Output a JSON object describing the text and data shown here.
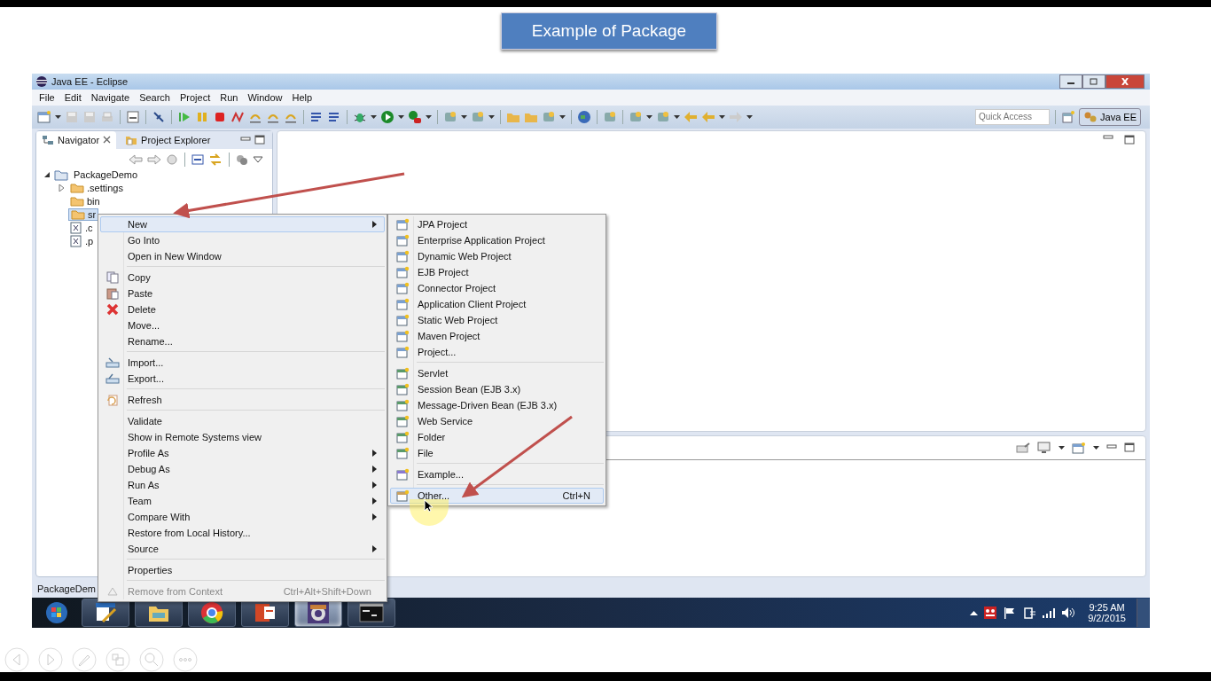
{
  "slide_title": "Example of Package",
  "window": {
    "title": "Java EE - Eclipse"
  },
  "menu_bar": [
    "File",
    "Edit",
    "Navigate",
    "Search",
    "Project",
    "Run",
    "Window",
    "Help"
  ],
  "quick_access": {
    "placeholder": "Quick Access"
  },
  "perspective": {
    "label": "Java EE",
    "selected": true
  },
  "view_tabs": [
    {
      "label": "Navigator",
      "selected": true,
      "closable": true
    },
    {
      "label": "Project Explorer",
      "selected": false
    }
  ],
  "tree": [
    {
      "label": "PackageDemo",
      "kind": "project",
      "expanded": true,
      "selected": false,
      "children": [
        {
          "label": ".settings",
          "kind": "folder",
          "expanded": false,
          "selected": false
        },
        {
          "label": "bin",
          "kind": "folder",
          "selected": false
        },
        {
          "label": "sr",
          "kind": "folder",
          "selected": true
        },
        {
          "label": ".c",
          "kind": "file",
          "selected": false
        },
        {
          "label": ".p",
          "kind": "file",
          "selected": false
        }
      ]
    }
  ],
  "context_menu": [
    [
      {
        "label": "New",
        "submenu": true,
        "selected": true
      },
      {
        "label": "Go Into",
        "selected": false
      },
      {
        "label": "Open in New Window",
        "selected": false
      }
    ],
    [
      {
        "label": "Copy",
        "kind": "copy",
        "selected": false
      },
      {
        "label": "Paste",
        "kind": "paste",
        "selected": false
      },
      {
        "label": "Delete",
        "kind": "delete",
        "selected": false
      },
      {
        "label": "Move...",
        "selected": false
      },
      {
        "label": "Rename...",
        "selected": false
      }
    ],
    [
      {
        "label": "Import...",
        "kind": "import",
        "selected": false
      },
      {
        "label": "Export...",
        "kind": "export",
        "selected": false
      }
    ],
    [
      {
        "label": "Refresh",
        "kind": "refresh",
        "selected": false
      }
    ],
    [
      {
        "label": "Validate",
        "selected": false
      },
      {
        "label": "Show in Remote Systems view",
        "selected": false
      },
      {
        "label": "Profile As",
        "submenu": true,
        "selected": false
      },
      {
        "label": "Debug As",
        "submenu": true,
        "selected": false
      },
      {
        "label": "Run As",
        "submenu": true,
        "selected": false
      },
      {
        "label": "Team",
        "submenu": true,
        "selected": false
      },
      {
        "label": "Compare With",
        "submenu": true,
        "selected": false
      },
      {
        "label": "Restore from Local History...",
        "selected": false
      },
      {
        "label": "Source",
        "submenu": true,
        "selected": false
      }
    ],
    [
      {
        "label": "Properties",
        "selected": false
      }
    ],
    [
      {
        "label": "Remove from Context",
        "kind": "context",
        "shortcut": "Ctrl+Alt+Shift+Down",
        "disabled": true,
        "selected": false
      }
    ]
  ],
  "new_submenu": [
    [
      {
        "label": "JPA Project",
        "selected": false
      },
      {
        "label": "Enterprise Application Project",
        "selected": false
      },
      {
        "label": "Dynamic Web Project",
        "selected": false
      },
      {
        "label": "EJB Project",
        "selected": false
      },
      {
        "label": "Connector Project",
        "selected": false
      },
      {
        "label": "Application Client Project",
        "selected": false
      },
      {
        "label": "Static Web Project",
        "selected": false
      },
      {
        "label": "Maven Project",
        "selected": false
      },
      {
        "label": "Project...",
        "selected": false
      }
    ],
    [
      {
        "label": "Servlet",
        "selected": false
      },
      {
        "label": "Session Bean (EJB 3.x)",
        "selected": false
      },
      {
        "label": "Message-Driven Bean (EJB 3.x)",
        "selected": false
      },
      {
        "label": "Web Service",
        "selected": false
      },
      {
        "label": "Folder",
        "selected": false
      },
      {
        "label": "File",
        "selected": false
      }
    ],
    [
      {
        "label": "Example...",
        "selected": false
      }
    ],
    [
      {
        "label": "Other...",
        "shortcut": "Ctrl+N",
        "selected": true
      }
    ]
  ],
  "status_bar": {
    "text": "PackageDem"
  },
  "taskbar": {
    "apps": [
      {
        "kind": "editor",
        "selected": false
      },
      {
        "kind": "folder",
        "selected": false
      },
      {
        "kind": "browser",
        "selected": false
      },
      {
        "kind": "slides",
        "selected": false
      },
      {
        "kind": "ide",
        "selected": true
      },
      {
        "kind": "terminal",
        "selected": false
      }
    ],
    "time": "9:25 AM",
    "date": "9/2/2015"
  }
}
